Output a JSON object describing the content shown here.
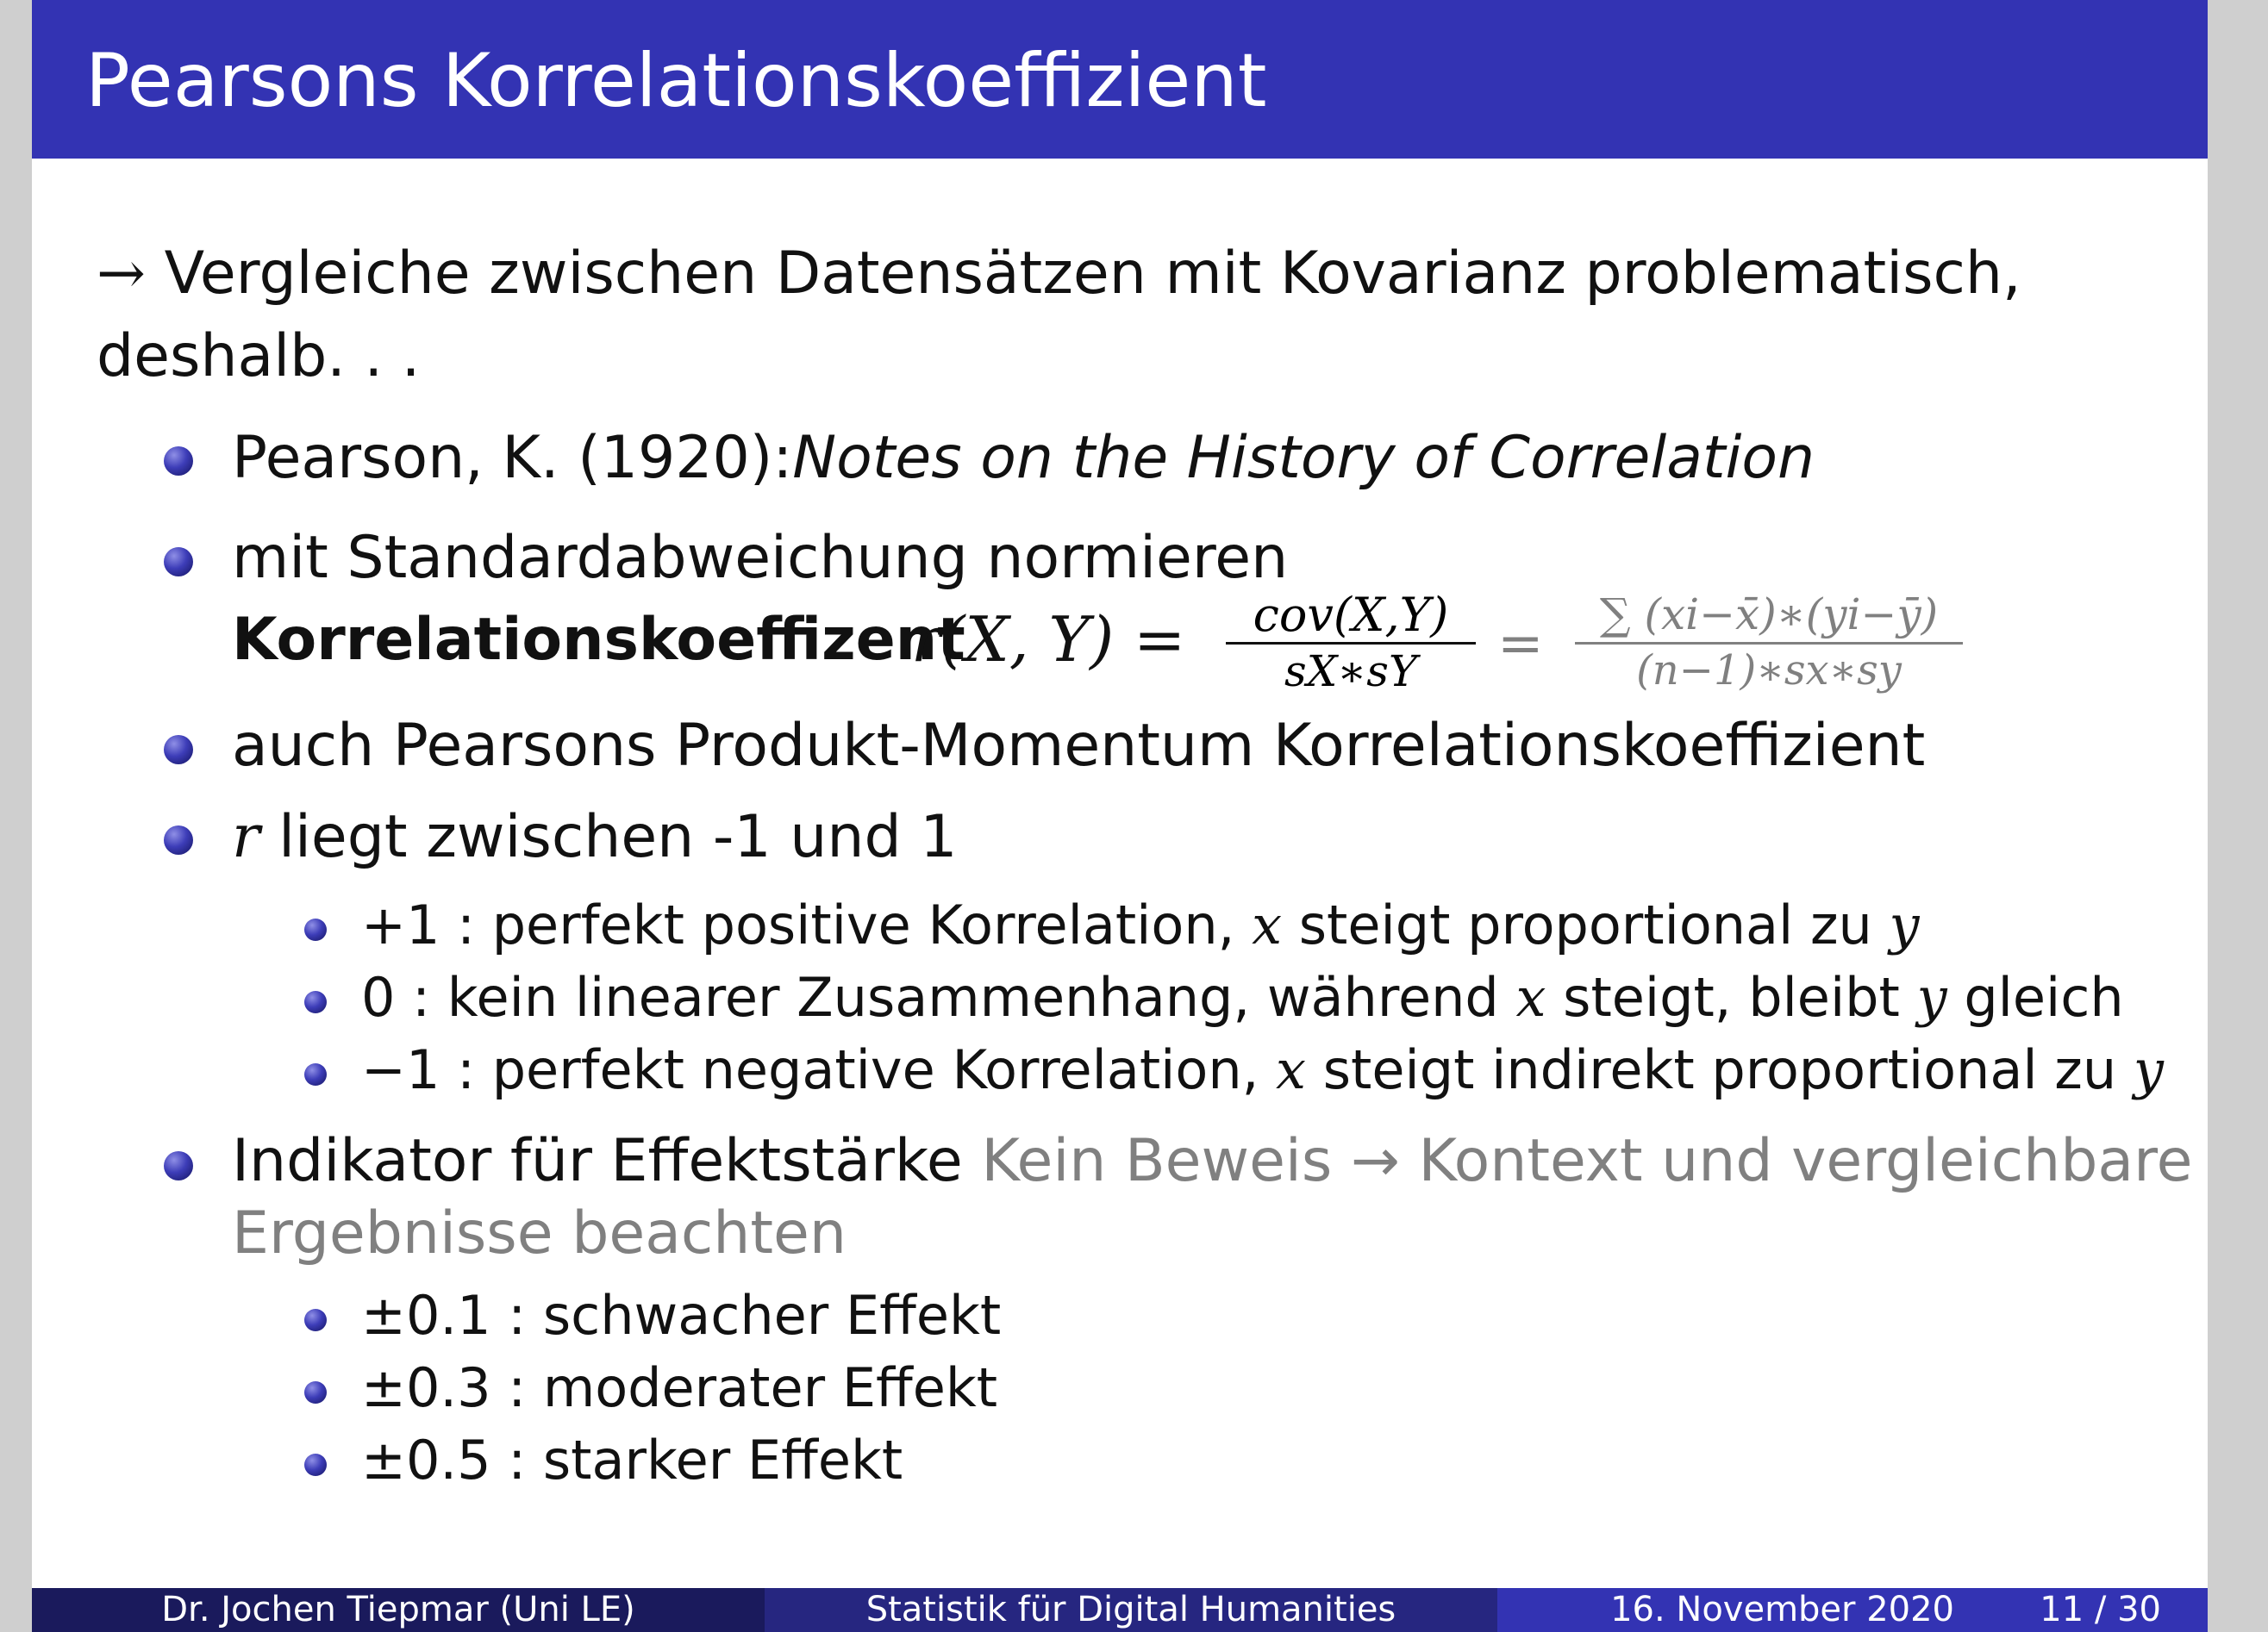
{
  "slide": {
    "title": "Pearsons Korrelationskoeffizient",
    "intro": {
      "arrow": "→",
      "line1": "Vergleiche zwischen Datensätzen mit Kovarianz problematisch,",
      "line2": "deshalb. . ."
    },
    "items": [
      {
        "text_plain": "Pearson, K. (1920):",
        "text_italic": "Notes on the History of Correlation"
      },
      {
        "line1": "mit Standardabweichung normieren",
        "bold_label": "Korrelationskoeffizent",
        "formula_lhs": "r(X, Y) =",
        "frac1_num": "cov(X,Y)",
        "frac1_den": "sX∗sY",
        "eq2": "=",
        "frac2_num": "∑ (xi−x̄)∗(yi−ȳ)",
        "frac2_den": "(n−1)∗sx∗sy"
      },
      {
        "text": "auch Pearsons Produkt-Momentum Korrelationskoeffizient"
      },
      {
        "var": "r",
        "text": "liegt zwischen -1 und 1"
      },
      {
        "text_dark": "Indikator für Effektstärke",
        "text_gray_1": "Kein Beweis → Kontext und vergleichbare",
        "text_gray_2": "Ergebnisse beachten"
      }
    ],
    "range_subitems": [
      {
        "prefix": "+1 : perfekt positive Korrelation,",
        "var1": "x",
        "mid": "steigt proportional zu",
        "var2": "y",
        "suffix": ""
      },
      {
        "prefix": "0 : kein linearer Zusammenhang, während",
        "var1": "x",
        "mid": "steigt, bleibt",
        "var2": "y",
        "suffix": "gleich"
      },
      {
        "prefix": "−1 : perfekt negative Korrelation,",
        "var1": "x",
        "mid": "steigt indirekt proportional zu",
        "var2": "y",
        "suffix": ""
      }
    ],
    "effect_subitems": [
      {
        "text": "±0.1 : schwacher Effekt"
      },
      {
        "text": "±0.3 : moderater Effekt"
      },
      {
        "text": "±0.5 : starker Effekt"
      }
    ]
  },
  "footer": {
    "author": "Dr. Jochen Tiepmar  (Uni LE)",
    "course": "Statistik für Digital Humanities",
    "date": "16. November 2020",
    "page": "11 / 30"
  },
  "colors": {
    "title_bar": "#3333b3",
    "footer_left": "#1a1a5c",
    "footer_mid": "#262680",
    "footer_right": "#3333b3",
    "gray_text": "#808080"
  }
}
